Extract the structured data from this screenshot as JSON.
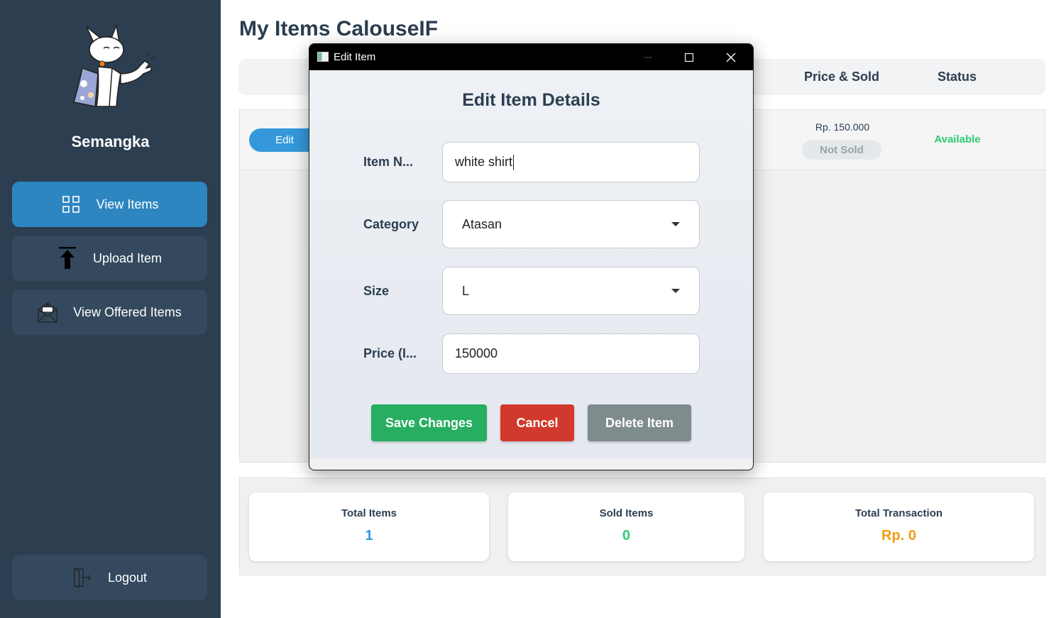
{
  "sidebar": {
    "username": "Semangka",
    "nav": [
      {
        "label": "View Items",
        "icon": "grid-icon",
        "active": true
      },
      {
        "label": "Upload Item",
        "icon": "upload-arrow-icon"
      },
      {
        "label": "View Offered Items",
        "icon": "offer-envelope-icon"
      }
    ],
    "logout_label": "Logout"
  },
  "main": {
    "title": "My Items CalouseIF",
    "table": {
      "headers": {
        "price_sold": "Price & Sold",
        "status": "Status"
      },
      "rows": [
        {
          "edit_label": "Edit",
          "price": "Rp. 150.000",
          "sold": "Not Sold",
          "status": "Available"
        }
      ]
    },
    "stats": [
      {
        "label": "Total Items",
        "value": "1",
        "color": "#3498db"
      },
      {
        "label": "Sold Items",
        "value": "0",
        "color": "#2ecc71"
      },
      {
        "label": "Total Transaction",
        "value": "Rp. 0",
        "color": "#f39c12"
      }
    ]
  },
  "dialog": {
    "window_title": "Edit Item",
    "heading": "Edit Item Details",
    "fields": {
      "name": {
        "label": "Item N...",
        "value": "white shirt"
      },
      "category": {
        "label": "Category",
        "value": "Atasan"
      },
      "size": {
        "label": "Size",
        "value": "L"
      },
      "price": {
        "label": "Price (I...",
        "value": "150000"
      }
    },
    "buttons": {
      "save": "Save Changes",
      "cancel": "Cancel",
      "delete": "Delete Item"
    },
    "button_colors": {
      "save": "#27ae60",
      "cancel": "#d0392b",
      "delete": "#7f8c8d"
    }
  }
}
